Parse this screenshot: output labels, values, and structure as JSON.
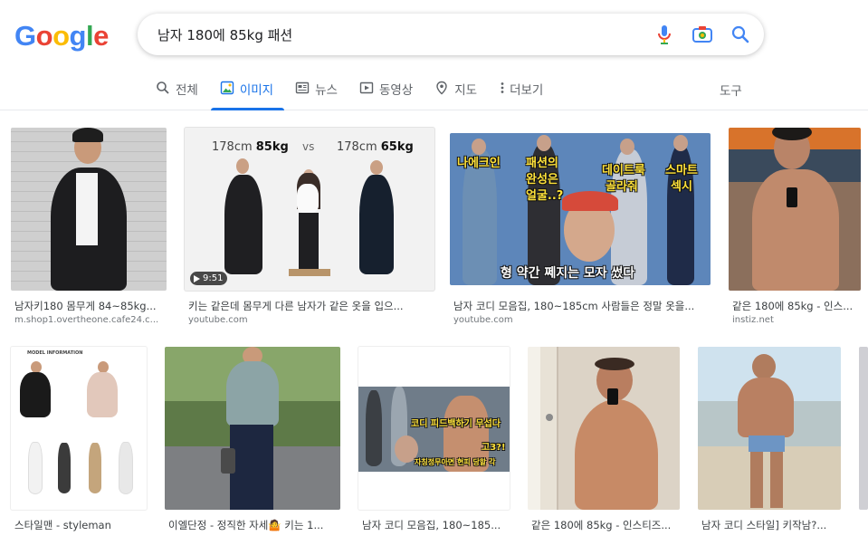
{
  "search": {
    "query": "남자 180에 85kg 패션"
  },
  "logo": {
    "letters": [
      "G",
      "o",
      "o",
      "g",
      "l",
      "e"
    ],
    "colors": [
      "#4285f4",
      "#ea4335",
      "#fbbc05",
      "#4285f4",
      "#34a853",
      "#ea4335"
    ]
  },
  "tabs": [
    {
      "label": "전체",
      "icon": "search-icon"
    },
    {
      "label": "이미지",
      "icon": "image-icon",
      "active": true
    },
    {
      "label": "뉴스",
      "icon": "news-icon"
    },
    {
      "label": "동영상",
      "icon": "video-icon"
    },
    {
      "label": "지도",
      "icon": "map-pin-icon"
    },
    {
      "label": "더보기",
      "icon": "more-vert-icon"
    }
  ],
  "tools_label": "도구",
  "accent": "#1a73e8",
  "results": [
    {
      "caption": "남자키180 몸무게 84~85kg...",
      "source": "m.shop1.overtheone.cafe24.c..."
    },
    {
      "caption": "키는 같은데 몸무게 다른 남자가 같은 옷을 입으...",
      "source": "youtube.com",
      "duration": "9:51",
      "overlay_left": "178cm",
      "overlay_left_kg": "85kg",
      "overlay_vs": "vs",
      "overlay_right": "178cm",
      "overlay_right_kg": "65kg"
    },
    {
      "caption": "남자 코디 모음집, 180~185cm 사람들은 정말 옷을...",
      "source": "youtube.com",
      "overlay_1": "나에크인",
      "overlay_2": "패션의",
      "overlay_3": "완성은",
      "overlay_4": "얼굴..?",
      "overlay_5": "데이트룩",
      "overlay_6": "골라줘",
      "overlay_7": "스마트",
      "overlay_8": "섹시",
      "overlay_bottom": "형 약간 쩨지는 모자 썼다"
    },
    {
      "caption": "같은 180에 85kg - 인스...",
      "source": "instiz.net"
    },
    {
      "caption": "스타일맨 - styleman",
      "overlay_title": "MODEL INFORMATION"
    },
    {
      "caption": "이엘단정 - 정직한 자세🤷 키는 1..."
    },
    {
      "caption": "남자 코디 모음집, 180~185...",
      "overlay_1": "코디 피드백하기 무섭다",
      "overlay_2": "고3?!",
      "overlay_3": "자칭정무아면 현피 당할 각"
    },
    {
      "caption": "같은 180에 85kg - 인스티즈..."
    },
    {
      "caption": "남자 코디 스타일] 키작남?..."
    }
  ]
}
